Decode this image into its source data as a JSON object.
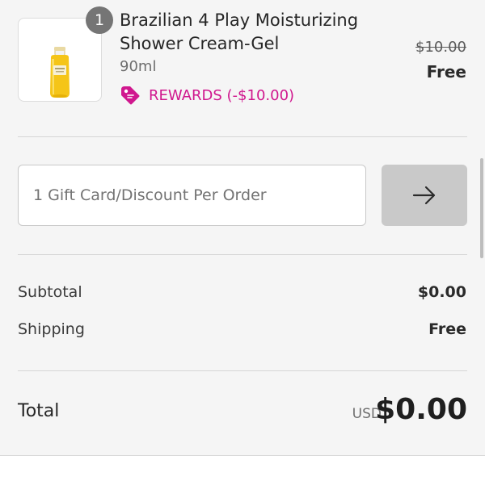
{
  "product": {
    "quantity": "1",
    "name": "Brazilian 4 Play Moisturizing Shower Cream-Gel",
    "variant": "90ml",
    "rewards_label": "REWARDS (-$10.00)",
    "original_price": "$10.00",
    "price": "Free",
    "image_icon": "shower-gel-bottle",
    "rewards_icon": "price-tag-icon"
  },
  "discount": {
    "placeholder": "1 Gift Card/Discount Per Order",
    "apply_icon": "arrow-right-icon"
  },
  "totals": {
    "subtotal_label": "Subtotal",
    "subtotal_value": "$0.00",
    "shipping_label": "Shipping",
    "shipping_value": "Free",
    "total_label": "Total",
    "currency": "USD",
    "total_value": "$0.00"
  },
  "colors": {
    "accent_pink": "#d0178e",
    "background": "#f5f5f5",
    "button_gray": "#c9c9c9"
  }
}
